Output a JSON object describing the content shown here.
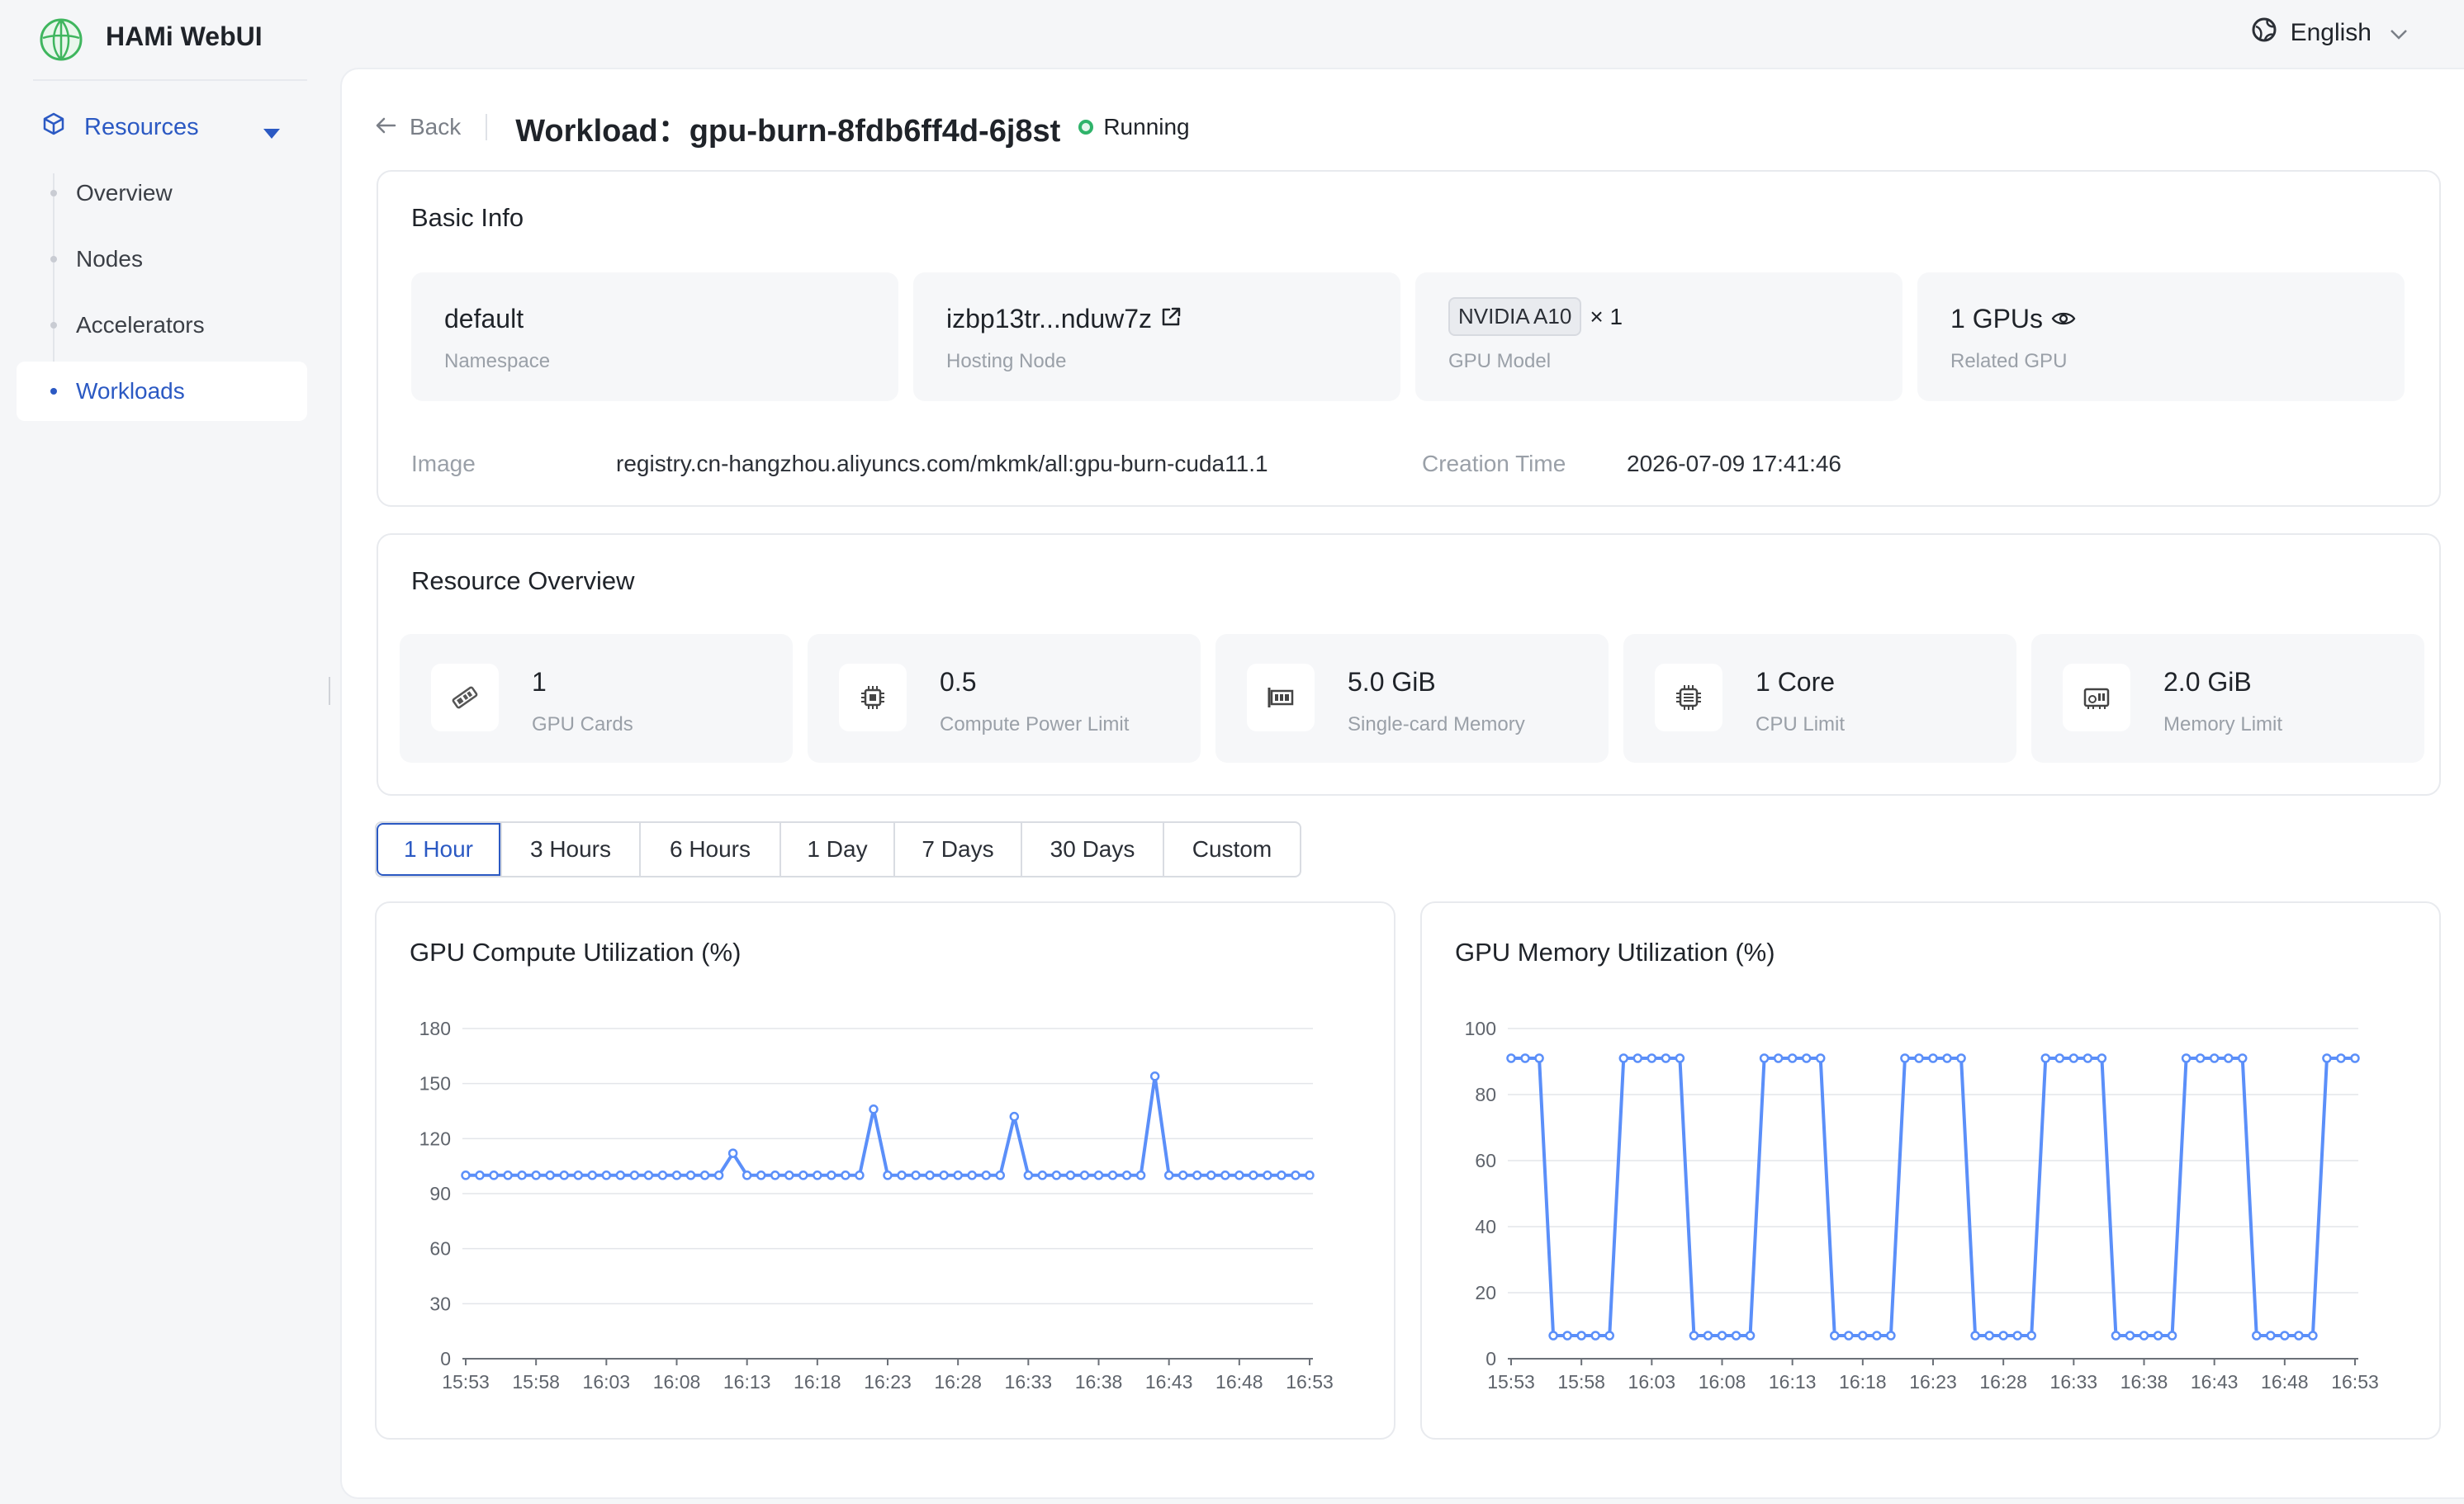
{
  "app": {
    "name": "HAMi WebUI"
  },
  "lang": {
    "label": "English"
  },
  "sidebar": {
    "group_label": "Resources",
    "items": [
      {
        "label": "Overview",
        "active": false
      },
      {
        "label": "Nodes",
        "active": false
      },
      {
        "label": "Accelerators",
        "active": false
      },
      {
        "label": "Workloads",
        "active": true
      }
    ]
  },
  "header": {
    "back_label": "Back",
    "title_prefix": "Workload：",
    "workload_name": "gpu-burn-8fdb6ff4d-6j8st",
    "status": "Running"
  },
  "basic_info": {
    "title": "Basic Info",
    "namespace": {
      "value": "default",
      "label": "Namespace"
    },
    "hosting_node": {
      "value": "izbp13tr...nduw7z",
      "label": "Hosting Node"
    },
    "gpu_model": {
      "value": "NVIDIA A10",
      "count": "× 1",
      "label": "GPU Model"
    },
    "related_gpu": {
      "value": "1 GPUs",
      "label": "Related GPU"
    },
    "image_label": "Image",
    "image_value": "registry.cn-hangzhou.aliyuncs.com/mkmk/all:gpu-burn-cuda11.1",
    "creation_label": "Creation Time",
    "creation_value": "2026-07-09 17:41:46"
  },
  "resource_overview": {
    "title": "Resource Overview",
    "tiles": [
      {
        "value": "1",
        "label": "GPU Cards",
        "icon": "gpu-card-icon"
      },
      {
        "value": "0.5",
        "label": "Compute Power Limit",
        "icon": "chip-icon"
      },
      {
        "value": "5.0 GiB",
        "label": "Single-card Memory",
        "icon": "memory-card-icon"
      },
      {
        "value": "1 Core",
        "label": "CPU Limit",
        "icon": "cpu-icon"
      },
      {
        "value": "2.0 GiB",
        "label": "Memory Limit",
        "icon": "ram-icon"
      }
    ]
  },
  "time_range": {
    "options": [
      "1 Hour",
      "3 Hours",
      "6 Hours",
      "1 Day",
      "7 Days",
      "30 Days",
      "Custom"
    ],
    "selected": "1 Hour"
  },
  "colors": {
    "accent": "#2b59c3",
    "series": "#5b8ff9",
    "running": "#2fb36a"
  },
  "chart_data": [
    {
      "type": "line",
      "title": "GPU Compute Utilization (%)",
      "xlabel": "",
      "ylabel": "",
      "ylim": [
        0,
        180
      ],
      "yticks": [
        0,
        30,
        60,
        90,
        120,
        150,
        180
      ],
      "x_ticks": [
        "15:53",
        "15:58",
        "16:03",
        "16:08",
        "16:13",
        "16:18",
        "16:23",
        "16:28",
        "16:33",
        "16:38",
        "16:43",
        "16:48",
        "16:53"
      ],
      "grid": true,
      "series": [
        {
          "values": [
            100,
            100,
            100,
            100,
            100,
            100,
            100,
            100,
            100,
            100,
            100,
            100,
            100,
            100,
            100,
            100,
            100,
            100,
            100,
            112,
            100,
            100,
            100,
            100,
            100,
            100,
            100,
            100,
            100,
            136,
            100,
            100,
            100,
            100,
            100,
            100,
            100,
            100,
            100,
            132,
            100,
            100,
            100,
            100,
            100,
            100,
            100,
            100,
            100,
            154,
            100,
            100,
            100,
            100,
            100,
            100,
            100,
            100,
            100,
            100,
            100
          ]
        }
      ]
    },
    {
      "type": "line",
      "title": "GPU Memory Utilization (%)",
      "xlabel": "",
      "ylabel": "",
      "ylim": [
        0,
        100
      ],
      "yticks": [
        0,
        20,
        40,
        60,
        80,
        100
      ],
      "x_ticks": [
        "15:53",
        "15:58",
        "16:03",
        "16:08",
        "16:13",
        "16:18",
        "16:23",
        "16:28",
        "16:33",
        "16:38",
        "16:43",
        "16:48",
        "16:53"
      ],
      "grid": true,
      "series": [
        {
          "values": [
            91,
            91,
            91,
            7,
            7,
            7,
            7,
            7,
            91,
            91,
            91,
            91,
            91,
            7,
            7,
            7,
            7,
            7,
            91,
            91,
            91,
            91,
            91,
            7,
            7,
            7,
            7,
            7,
            91,
            91,
            91,
            91,
            91,
            7,
            7,
            7,
            7,
            7,
            91,
            91,
            91,
            91,
            91,
            7,
            7,
            7,
            7,
            7,
            91,
            91,
            91,
            91,
            91,
            7,
            7,
            7,
            7,
            7,
            91,
            91,
            91
          ]
        }
      ]
    }
  ]
}
